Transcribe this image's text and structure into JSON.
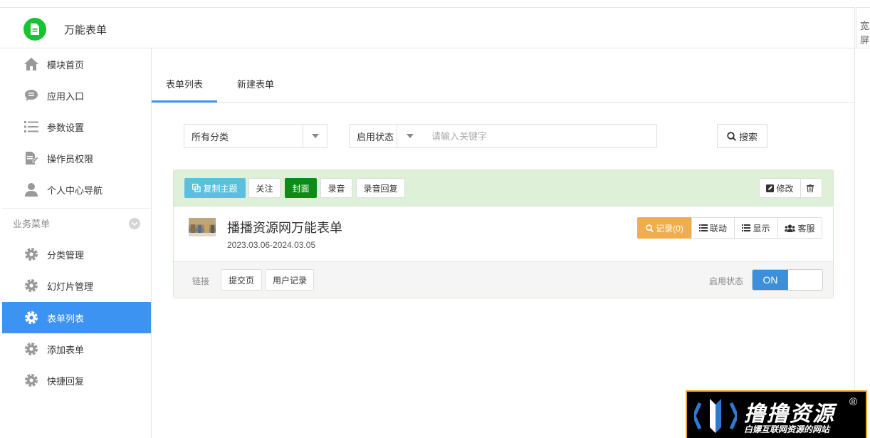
{
  "header": {
    "app_title": "万能表单",
    "wide_label": "宽屏"
  },
  "sidebar": {
    "items": [
      {
        "label": "模块首页"
      },
      {
        "label": "应用入口"
      },
      {
        "label": "参数设置"
      },
      {
        "label": "操作员权限"
      },
      {
        "label": "个人中心导航"
      }
    ],
    "group_label": "业务菜单",
    "group_items": [
      {
        "label": "分类管理"
      },
      {
        "label": "幻灯片管理"
      },
      {
        "label": "表单列表",
        "active": true
      },
      {
        "label": "添加表单"
      },
      {
        "label": "快捷回复"
      }
    ]
  },
  "tabs": [
    {
      "label": "表单列表",
      "active": true
    },
    {
      "label": "新建表单"
    }
  ],
  "filters": {
    "category": "所有分类",
    "status": "启用状态",
    "keyword_placeholder": "请输入关键字",
    "search_label": "搜索"
  },
  "card": {
    "head_buttons": {
      "copy_theme": "复制主题",
      "follow": "关注",
      "cover": "封面",
      "record_audio": "录音",
      "audio_reply": "录音回复",
      "edit": "修改"
    },
    "form_name": "播播资源网万能表单",
    "form_date": "2023.03.06-2024.03.05",
    "action_buttons": {
      "records": "记录(0)",
      "linkage": "联动",
      "display": "显示",
      "service": "客服"
    },
    "footer": {
      "link_label": "链接",
      "submit_page": "提交页",
      "user_records": "用户记录",
      "status_label": "启用状态",
      "toggle_on": "ON"
    }
  },
  "watermark": {
    "title": "撸撸资源",
    "reg": "®",
    "subtitle": "白嫖互联网资源的网站"
  },
  "colors": {
    "accent": "#3c93f2",
    "brand_green": "#19c230",
    "card_header": "#dff0d8",
    "warn": "#f0ad4e",
    "info": "#5bc0de",
    "green_btn": "#0e8a16"
  }
}
